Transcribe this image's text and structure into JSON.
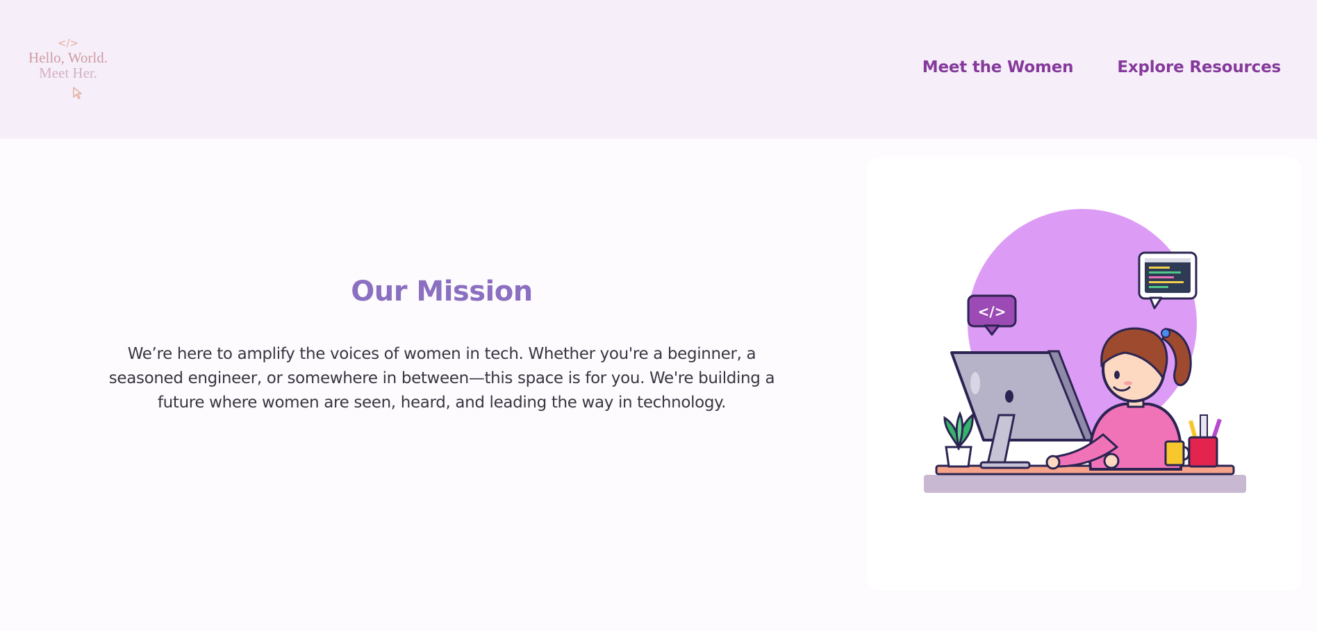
{
  "header": {
    "logo": {
      "code_symbol": "</>",
      "line1": "Hello, World.",
      "line2": "Meet Her."
    },
    "nav": [
      {
        "label": "Meet the Women"
      },
      {
        "label": "Explore Resources"
      }
    ]
  },
  "mission": {
    "title": "Our Mission",
    "body": "We’re here to amplify the voices of women in tech. Whether you're a beginner, a seasoned engineer, or somewhere in between—this space is for you. We're building a future where women are seen, heard, and leading the way in technology."
  },
  "illustration": {
    "icons": [
      "woman-coding-illustration",
      "code-bubble-icon",
      "browser-window-icon",
      "computer-monitor-icon",
      "plant-icon",
      "mug-icon",
      "pen-holder-icon"
    ],
    "colors": {
      "circle": "#dc9cf5",
      "bubble": "#9c4ab5",
      "shirt": "#f073b8",
      "hair": "#9d4a2f",
      "desk": "#f7a38a",
      "shadow": "#c8b8d2"
    },
    "code_bubble_symbol": "</>"
  },
  "theme": {
    "header_bg": "#f6eff9",
    "page_bg": "#fdfbfe",
    "nav_color": "#853a9b",
    "title_color": "#8b6fc0",
    "text_color": "#3a3440"
  }
}
